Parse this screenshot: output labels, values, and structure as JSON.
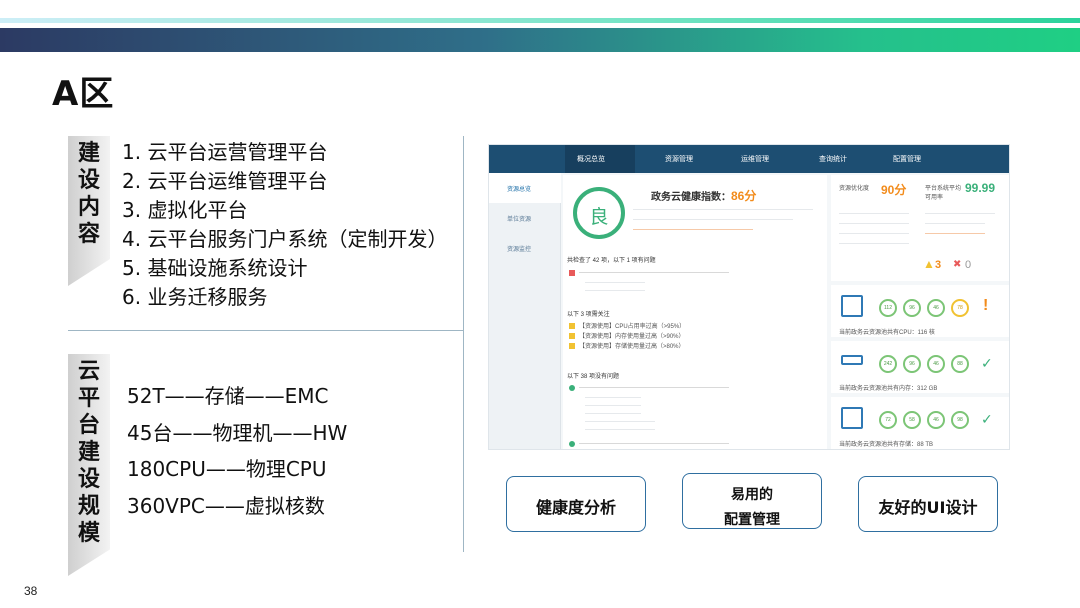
{
  "slide": {
    "title": "A区",
    "page_number": "38"
  },
  "section1": {
    "tag": "建设内容",
    "items": [
      "1.  云平台运营管理平台",
      "2.  云平台运维管理平台",
      "3.  虚拟化平台",
      "4.  云平台服务门户系统（定制开发）",
      "5.  基础设施系统设计",
      "6.  业务迁移服务"
    ]
  },
  "section2": {
    "tag": "云平台建设规模",
    "items": [
      "52T——存储——EMC",
      "45台——物理机——HW",
      "180CPU——物理CPU",
      "360VPC——虚拟核数"
    ]
  },
  "screenshot": {
    "nav": [
      "概况总览",
      "资源管理",
      "运维管理",
      "查询统计",
      "配置管理"
    ],
    "left_nav": [
      "资源总览",
      "单位资源",
      "资源监控"
    ],
    "grade": "良",
    "health_label": "政务云健康指数：",
    "health_score": "86分",
    "score_a_label": "资源优化度",
    "score_a": "90分",
    "score_b_label": "平台系统平均可用率",
    "score_b": "99.99",
    "warn_count": "3",
    "err_count": "0",
    "check_summary": "共检查了 42 项，以下 1 项有问题",
    "attention": "以下 3 项需关注",
    "normal": "以下 38 项没有问题",
    "rows": [
      "【资源使用】CPU占用率过高（>95%）",
      "【资源使用】内存使用量过高（>90%）",
      "【资源使用】存储使用量过高（>80%）"
    ],
    "gauges": [
      [
        "112",
        "96",
        "46",
        "78"
      ],
      [
        "242",
        "96",
        "46",
        "88"
      ],
      [
        "72",
        "58",
        "46",
        "98"
      ]
    ],
    "gauge_notes": [
      "当前政务云资源池共有CPU：116 核",
      "当前政务云资源池共有内存：312 GB",
      "当前政务云资源池共有存储：88 TB"
    ]
  },
  "features": {
    "f1": "健康度分析",
    "f2_line1": "易用的",
    "f2_line2": "配置管理",
    "f3": "友好的UI设计"
  },
  "colors": {
    "nav_blue": "#1d4e72",
    "accent_green": "#3ab07a",
    "accent_orange": "#f28b1b",
    "border_blue": "#2f6fa0"
  }
}
